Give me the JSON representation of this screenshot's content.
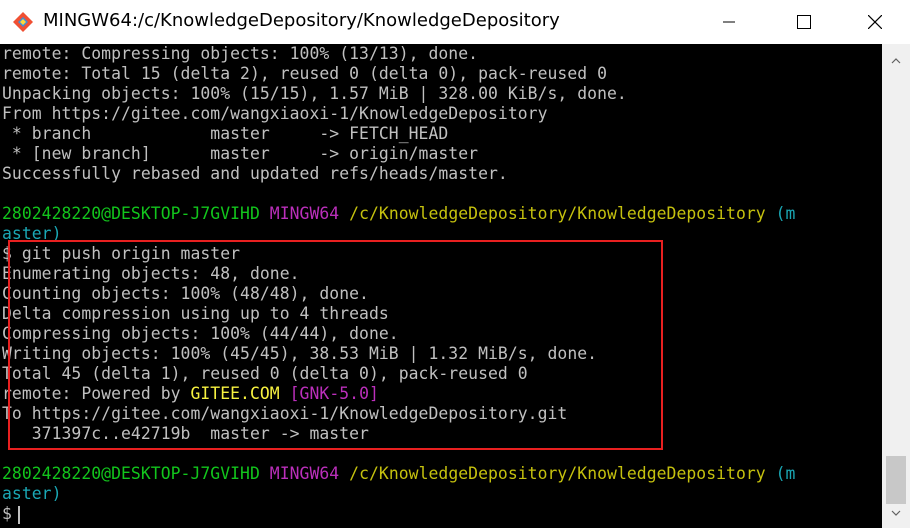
{
  "window": {
    "title": "MINGW64:/c/KnowledgeDepository/KnowledgeDepository",
    "icon": "git-bash-icon",
    "controls": {
      "minimize": "minimize-icon",
      "maximize": "maximize-icon",
      "close": "close-icon"
    }
  },
  "colors": {
    "terminal_bg": "#000000",
    "text": "#c0c0c0",
    "prompt_user": "#12c51c",
    "prompt_env": "#bb2fbb",
    "prompt_path": "#c5c10e",
    "prompt_branch": "#1aa8b5",
    "highlight_box": "#e82020"
  },
  "terminal": {
    "lines": [
      {
        "text": "remote: Compressing objects: 100% (13/13), done."
      },
      {
        "text": "remote: Total 15 (delta 2), reused 0 (delta 0), pack-reused 0"
      },
      {
        "text": "Unpacking objects: 100% (15/15), 1.57 MiB | 328.00 KiB/s, done."
      },
      {
        "text": "From https://gitee.com/wangxiaoxi-1/KnowledgeDepository"
      },
      {
        "text": " * branch            master     -> FETCH_HEAD"
      },
      {
        "text": " * [new branch]      master     -> origin/master"
      },
      {
        "text": "Successfully rebased and updated refs/heads/master."
      },
      {
        "text": ""
      }
    ],
    "prompt1": {
      "user": "2802428220@DESKTOP-J7GVIHD",
      "env": "MINGW64",
      "path": "/c/KnowledgeDepository/KnowledgeDepository",
      "branch_open": "(m",
      "branch_rest": "aster)"
    },
    "command": "$ git push origin master",
    "output": [
      "Enumerating objects: 48, done.",
      "Counting objects: 100% (48/48), done.",
      "Delta compression using up to 4 threads",
      "Compressing objects: 100% (44/44), done.",
      "Writing objects: 100% (45/45), 38.53 MiB | 1.32 MiB/s, done.",
      "Total 45 (delta 1), reused 0 (delta 0), pack-reused 0"
    ],
    "remote_powered": {
      "prefix": "remote: Powered by ",
      "brand": "GITEE.COM",
      "space": " ",
      "version": "[GNK-5.0]"
    },
    "push_to": "To https://gitee.com/wangxiaoxi-1/KnowledgeDepository.git",
    "push_ref": "   371397c..e42719b  master -> master",
    "prompt2": {
      "user": "2802428220@DESKTOP-J7GVIHD",
      "env": "MINGW64",
      "path": "/c/KnowledgeDepository/KnowledgeDepository",
      "branch_open": "(m",
      "branch_rest": "aster)"
    },
    "input_prompt": "$"
  }
}
